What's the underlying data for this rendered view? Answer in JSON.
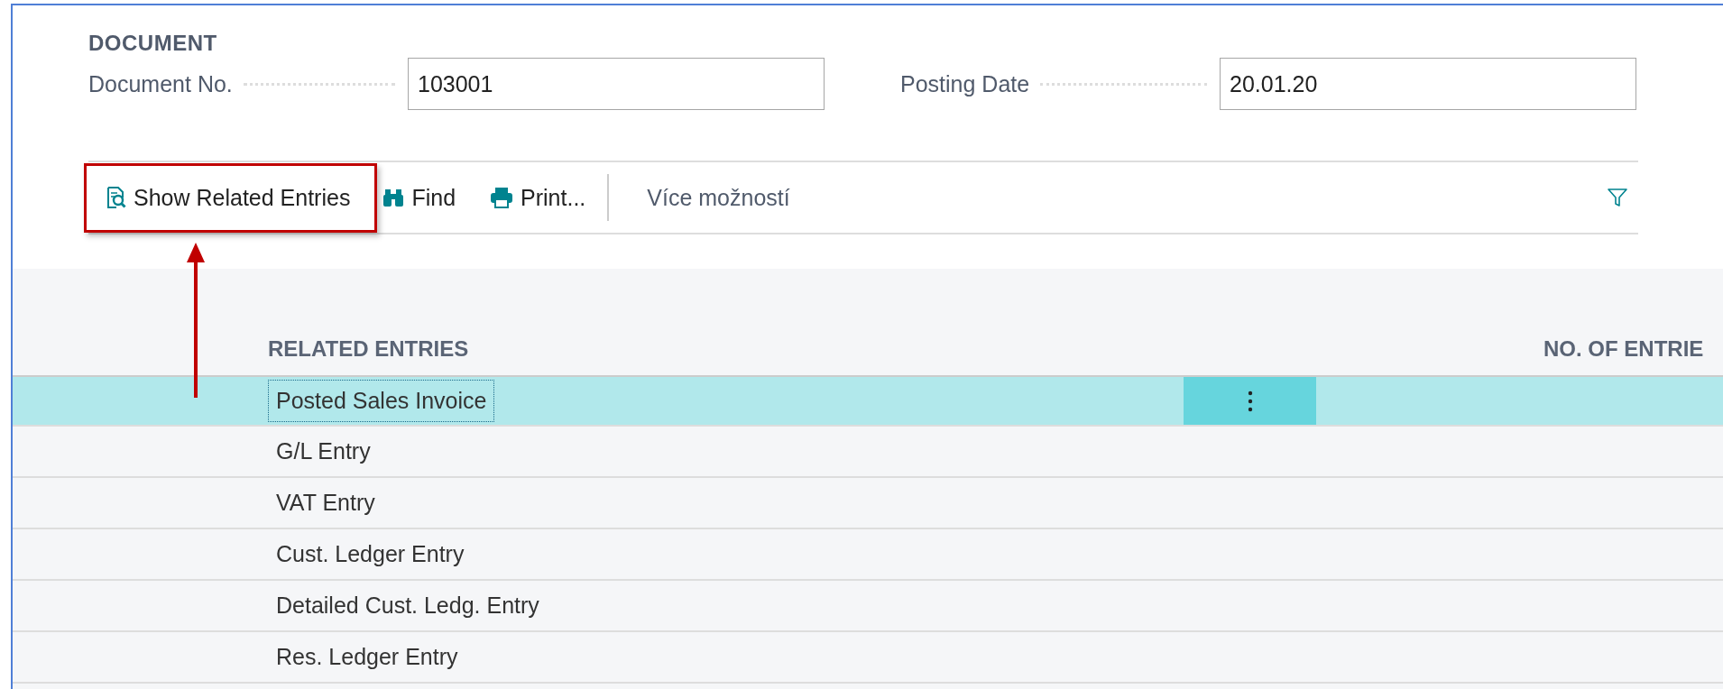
{
  "document": {
    "heading": "DOCUMENT",
    "fields": [
      {
        "label": "Document No.",
        "value": "103001"
      },
      {
        "label": "Posting Date",
        "value": "20.01.20"
      }
    ]
  },
  "toolbar": {
    "actions": [
      {
        "kind": "related",
        "label": "Show Related Entries",
        "highlighted": true
      },
      {
        "kind": "find",
        "label": "Find",
        "highlighted": false
      },
      {
        "kind": "print",
        "label": "Print...",
        "highlighted": false
      }
    ],
    "more": "Více možností"
  },
  "table": {
    "columns": [
      "RELATED ENTRIES",
      "NO. OF ENTRIE"
    ],
    "rows": [
      {
        "name": "Posted Sales Invoice",
        "selected": true
      },
      {
        "name": "G/L Entry",
        "selected": false
      },
      {
        "name": "VAT Entry",
        "selected": false
      },
      {
        "name": "Cust. Ledger Entry",
        "selected": false
      },
      {
        "name": "Detailed Cust. Ledg. Entry",
        "selected": false
      },
      {
        "name": "Res. Ledger Entry",
        "selected": false
      }
    ]
  }
}
